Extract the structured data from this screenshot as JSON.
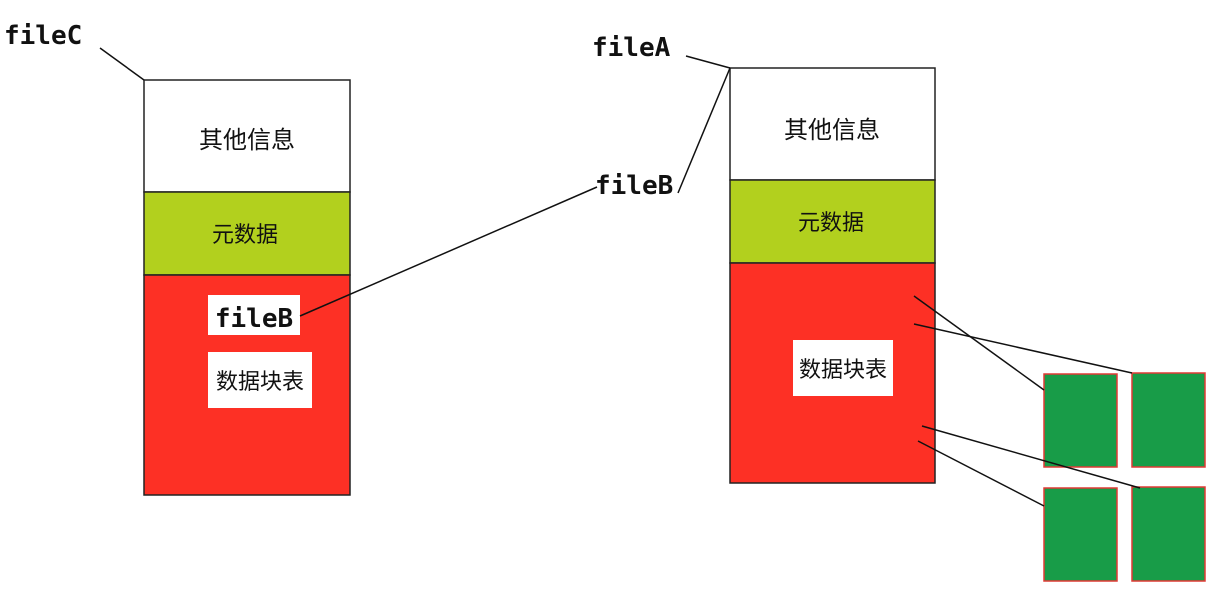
{
  "left_file": {
    "name_label": "fileC",
    "sections": {
      "other_info": "其他信息",
      "metadata": "元数据",
      "data_block_table": "数据块表"
    },
    "entry_label": "fileB"
  },
  "right_file": {
    "name_labels": [
      "fileA",
      "fileB"
    ],
    "sections": {
      "other_info": "其他信息",
      "metadata": "元数据",
      "data_block_table": "数据块表"
    }
  },
  "colors": {
    "other_info_fill": "#ffffff",
    "metadata_fill": "#b2d01e",
    "data_block_table_fill": "#fd3025",
    "data_block_fill": "#189c48",
    "data_block_border": "#e03a35",
    "outline": "#222222",
    "connector": "#111111"
  }
}
